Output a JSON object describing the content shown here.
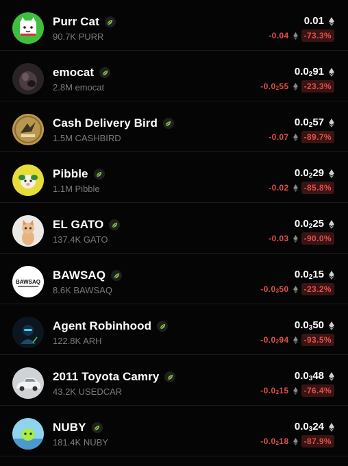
{
  "tokens": [
    {
      "name": "Purr Cat",
      "sub": "90.7K PURR",
      "price_main": "0.01",
      "price_sub": "",
      "price_rest": "",
      "delta_main": "-0.04",
      "delta_sub": "",
      "delta_rest": "",
      "pct": "-73.3%",
      "avatar": "purr-cat-avatar"
    },
    {
      "name": "emocat",
      "sub": "2.8M emocat",
      "price_main": "0.0",
      "price_sub": "2",
      "price_rest": "91",
      "delta_main": "-0.0",
      "delta_sub": "2",
      "delta_rest": "55",
      "pct": "-23.3%",
      "avatar": "emocat-avatar"
    },
    {
      "name": "Cash Delivery Bird",
      "sub": "1.5M CASHBIRD",
      "price_main": "0.0",
      "price_sub": "2",
      "price_rest": "57",
      "delta_main": "-0.07",
      "delta_sub": "",
      "delta_rest": "",
      "pct": "-89.7%",
      "avatar": "cash-bird-avatar"
    },
    {
      "name": "Pibble",
      "sub": "1.1M Pibble",
      "price_main": "0.0",
      "price_sub": "2",
      "price_rest": "29",
      "delta_main": "-0.02",
      "delta_sub": "",
      "delta_rest": "",
      "pct": "-85.8%",
      "avatar": "pibble-avatar"
    },
    {
      "name": "EL GATO",
      "sub": "137.4K GATO",
      "price_main": "0.0",
      "price_sub": "2",
      "price_rest": "25",
      "delta_main": "-0.03",
      "delta_sub": "",
      "delta_rest": "",
      "pct": "-90.0%",
      "avatar": "el-gato-avatar"
    },
    {
      "name": "BAWSAQ",
      "sub": "8.6K BAWSAQ",
      "price_main": "0.0",
      "price_sub": "2",
      "price_rest": "15",
      "delta_main": "-0.0",
      "delta_sub": "3",
      "delta_rest": "50",
      "pct": "-23.2%",
      "avatar": "bawsaq-avatar",
      "avatar_text": "BAWSAQ"
    },
    {
      "name": "Agent Robinhood",
      "sub": "122.8K ARH",
      "price_main": "0.0",
      "price_sub": "3",
      "price_rest": "50",
      "delta_main": "-0.0",
      "delta_sub": "2",
      "delta_rest": "94",
      "pct": "-93.5%",
      "avatar": "robinhood-avatar"
    },
    {
      "name": "2011 Toyota Camry",
      "sub": "43.2K USEDCAR",
      "price_main": "0.0",
      "price_sub": "3",
      "price_rest": "48",
      "delta_main": "-0.0",
      "delta_sub": "2",
      "delta_rest": "15",
      "pct": "-76.4%",
      "avatar": "camry-avatar"
    },
    {
      "name": "NUBY",
      "sub": "181.4K NUBY",
      "price_main": "0.0",
      "price_sub": "3",
      "price_rest": "24",
      "delta_main": "-0.0",
      "delta_sub": "2",
      "delta_rest": "18",
      "pct": "-87.9%",
      "avatar": "nuby-avatar"
    }
  ],
  "colors": {
    "negative": "#e0504a",
    "negative_bg": "#3a1414",
    "muted": "#7a7a7a",
    "leaf": "#8bc34a"
  },
  "icons": {
    "verified": "leaf-icon",
    "chain": "eth-icon"
  }
}
